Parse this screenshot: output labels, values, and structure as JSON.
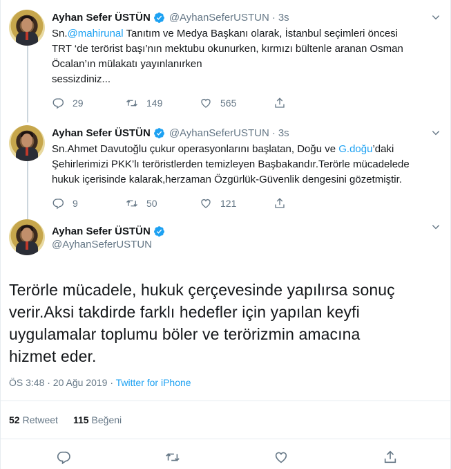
{
  "tweets": [
    {
      "name": "Ayhan Sefer ÜSTÜN",
      "handle": "@AyhanSeferUSTUN",
      "dot": "·",
      "time": "3s",
      "text_prefix": "Sn.",
      "mention": "@mahirunal",
      "text_line1_rest": " Tanıtım ve Medya Başkanı olarak, İstanbul seçimleri öncesi",
      "text_line2": "TRT ‘de terörist başı’nın mektubu okunurken, kırmızı bültenle aranan Osman",
      "text_line3": "Öcalan’ın mülakatı yayınlanırken",
      "text_line4": "sessizdiniz...",
      "replies": "29",
      "retweets": "149",
      "likes": "565"
    },
    {
      "name": "Ayhan Sefer ÜSTÜN",
      "handle": "@AyhanSeferUSTUN",
      "dot": "·",
      "time": "3s",
      "text_line1_a": "Sn.Ahmet Davutoğlu çukur operasyonlarını başlatan, Doğu ve ",
      "text_line1_link": "G.doğu",
      "text_line1_b": "’daki",
      "text_line2": "Şehirlerimizi PKK’lı teröristlerden temizleyen Başbakandır.Terörle mücadelede",
      "text_line3": "hukuk içerisinde kalarak,herzaman Özgürlük-Güvenlik dengesini gözetmiştir.",
      "replies": "9",
      "retweets": "50",
      "likes": "121"
    }
  ],
  "main": {
    "name": "Ayhan Sefer ÜSTÜN",
    "handle": "@AyhanSeferUSTUN",
    "text_line1": "Terörle mücadele, hukuk çerçevesinde yapılırsa sonuç",
    "text_line2": "verir.Aksi takdirde farklı hedefler için yapılan keyfi",
    "text_line3": "uygulamalar toplumu böler ve terörizmin amacına",
    "text_line4": "hizmet eder.",
    "timestamp": "ÖS 3:48 · 20 Ağu 2019 · ",
    "source": "Twitter for iPhone",
    "retweet_count": "52",
    "retweet_label": "Retweet",
    "like_count": "115",
    "like_label": "Beğeni"
  },
  "icons": [
    "verified-badge-icon",
    "chevron-down-icon",
    "reply-icon",
    "retweet-icon",
    "like-icon",
    "share-icon"
  ],
  "colors": {
    "accent": "#1da1f2",
    "muted": "#657786",
    "text": "#14171a",
    "border": "#e6ecf0"
  }
}
